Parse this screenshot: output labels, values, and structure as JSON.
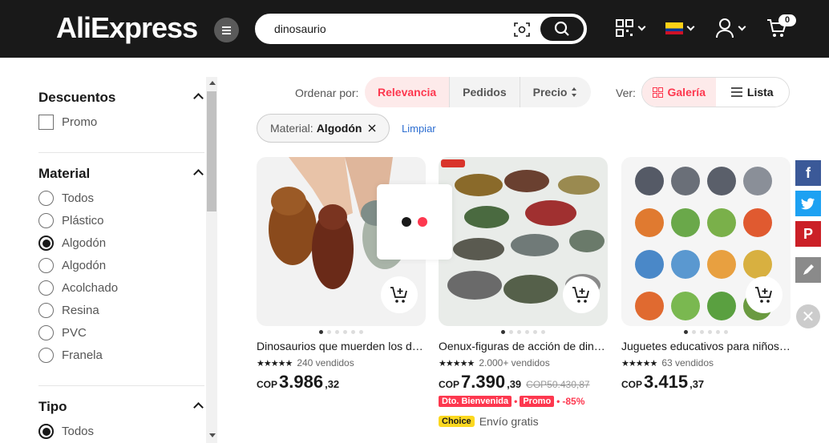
{
  "header": {
    "logo": "AliExpress",
    "search_value": "dinosaurio",
    "cart_count": "0"
  },
  "sidebar": {
    "discounts_title": "Descuentos",
    "discounts_option": "Promo",
    "material_title": "Material",
    "material_options": [
      "Todos",
      "Plástico",
      "Algodón",
      "Algodón",
      "Acolchado",
      "Resina",
      "PVC",
      "Franela"
    ],
    "material_selected_index": 2,
    "type_title": "Tipo",
    "type_options": [
      "Todos"
    ]
  },
  "sort": {
    "label": "Ordenar por:",
    "options": [
      "Relevancia",
      "Pedidos",
      "Precio"
    ],
    "view_label": "Ver:",
    "view_options": [
      "Galería",
      "Lista"
    ]
  },
  "filters": {
    "chip_key": "Material:",
    "chip_value": "Algodón",
    "clear": "Limpiar"
  },
  "products": [
    {
      "title": "Dinosaurios que muerden los dedos",
      "sold": "240 vendidos",
      "currency": "COP",
      "price_int": "3.986",
      "price_dec": ",32"
    },
    {
      "title": "Oenux-figuras de acción de dinosaurios",
      "sold": "2.000+ vendidos",
      "currency": "COP",
      "price_int": "7.390",
      "price_dec": ",39",
      "old_price": "COP50.430,87",
      "badge1": "Dto. Bienvenida",
      "badge2": "Promo",
      "discount": "-85%",
      "choice": "Choice",
      "shipping": "Envío gratis"
    },
    {
      "title": "Juguetes educativos para niños dinosaurios",
      "sold": "63 vendidos",
      "currency": "COP",
      "price_int": "3.415",
      "price_dec": ",37"
    }
  ],
  "colors": {
    "accent": "#fd384f",
    "header_bg": "#191919",
    "facebook": "#3b5998",
    "twitter": "#1da1f2",
    "pinterest": "#cb2027",
    "edit": "#8a8a8a"
  }
}
